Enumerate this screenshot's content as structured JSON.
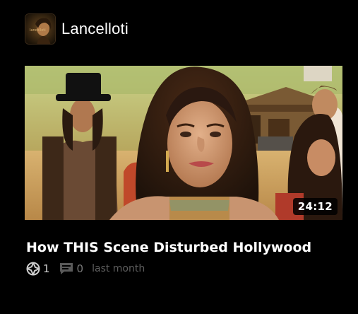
{
  "channel": {
    "name": "Lancelloti",
    "avatar_icon": "channel-avatar-icon"
  },
  "video": {
    "thumbnail_icon": "video-thumbnail-image",
    "duration": "24:12",
    "title": "How THIS Scene Disturbed Hollywood",
    "views": "1",
    "views_icon": "views-icon",
    "comments": "0",
    "comments_icon": "comment-icon",
    "published": "last month"
  },
  "colors": {
    "background": "#000000",
    "text_primary": "#ffffff",
    "text_muted": "#5f5f5f"
  }
}
